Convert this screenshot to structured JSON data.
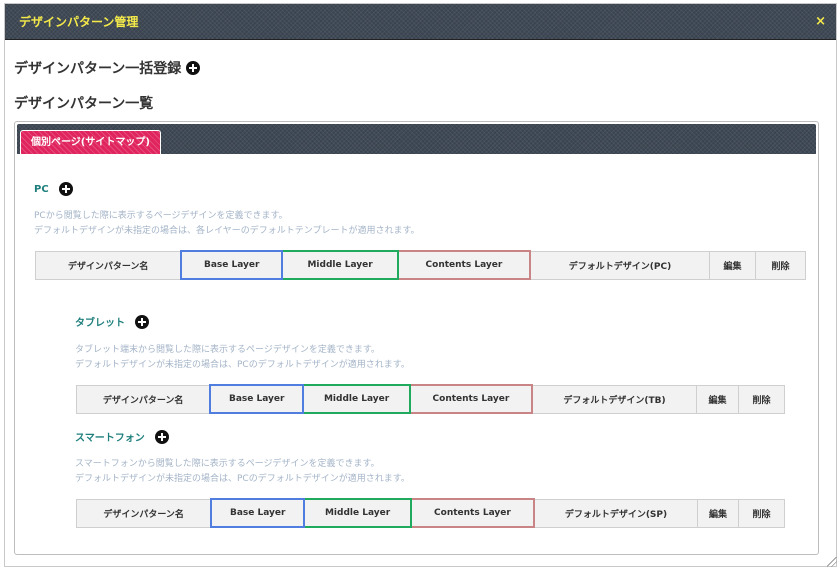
{
  "window": {
    "title": "デザインパターン管理",
    "close_glyph": "×"
  },
  "headings": {
    "bulk_register": "デザインパターン一括登録",
    "list": "デザインパターン一覧"
  },
  "tab": {
    "label": "個別ページ(サイトマップ)"
  },
  "sections": {
    "pc": {
      "title": "PC",
      "desc1": "PCから閲覧した際に表示するページデザインを定義できます。",
      "desc2": "デフォルトデザインが未指定の場合は、各レイヤーのデフォルトテンプレートが適用されます。",
      "columns": [
        "デザインパターン名",
        "Base Layer",
        "Middle Layer",
        "Contents Layer",
        "デフォルトデザイン(PC)",
        "編集",
        "削除"
      ]
    },
    "tablet": {
      "title": "タブレット",
      "desc1": "タブレット端末から閲覧した際に表示するページデザインを定義できます。",
      "desc2": "デフォルトデザインが未指定の場合は、PCのデフォルトデザインが適用されます。",
      "columns": [
        "デザインパターン名",
        "Base Layer",
        "Middle Layer",
        "Contents Layer",
        "デフォルトデザイン(TB)",
        "編集",
        "削除"
      ]
    },
    "sp": {
      "title": "スマートフォン",
      "desc1": "スマートフォンから閲覧した際に表示するページデザインを定義できます。",
      "desc2": "デフォルトデザインが未指定の場合は、PCのデフォルトデザインが適用されます。",
      "columns": [
        "デザインパターン名",
        "Base Layer",
        "Middle Layer",
        "Contents Layer",
        "デフォルトデザイン(SP)",
        "編集",
        "削除"
      ]
    }
  },
  "colors": {
    "title_text": "#f4e94a",
    "tab_bg": "#e0245e",
    "section_title": "#1e7f7c",
    "base_border": "#4f7de0",
    "middle_border": "#1faa5e",
    "contents_border": "#c98585"
  },
  "icons": {
    "close": "close-icon",
    "add": "plus-circle-icon"
  }
}
